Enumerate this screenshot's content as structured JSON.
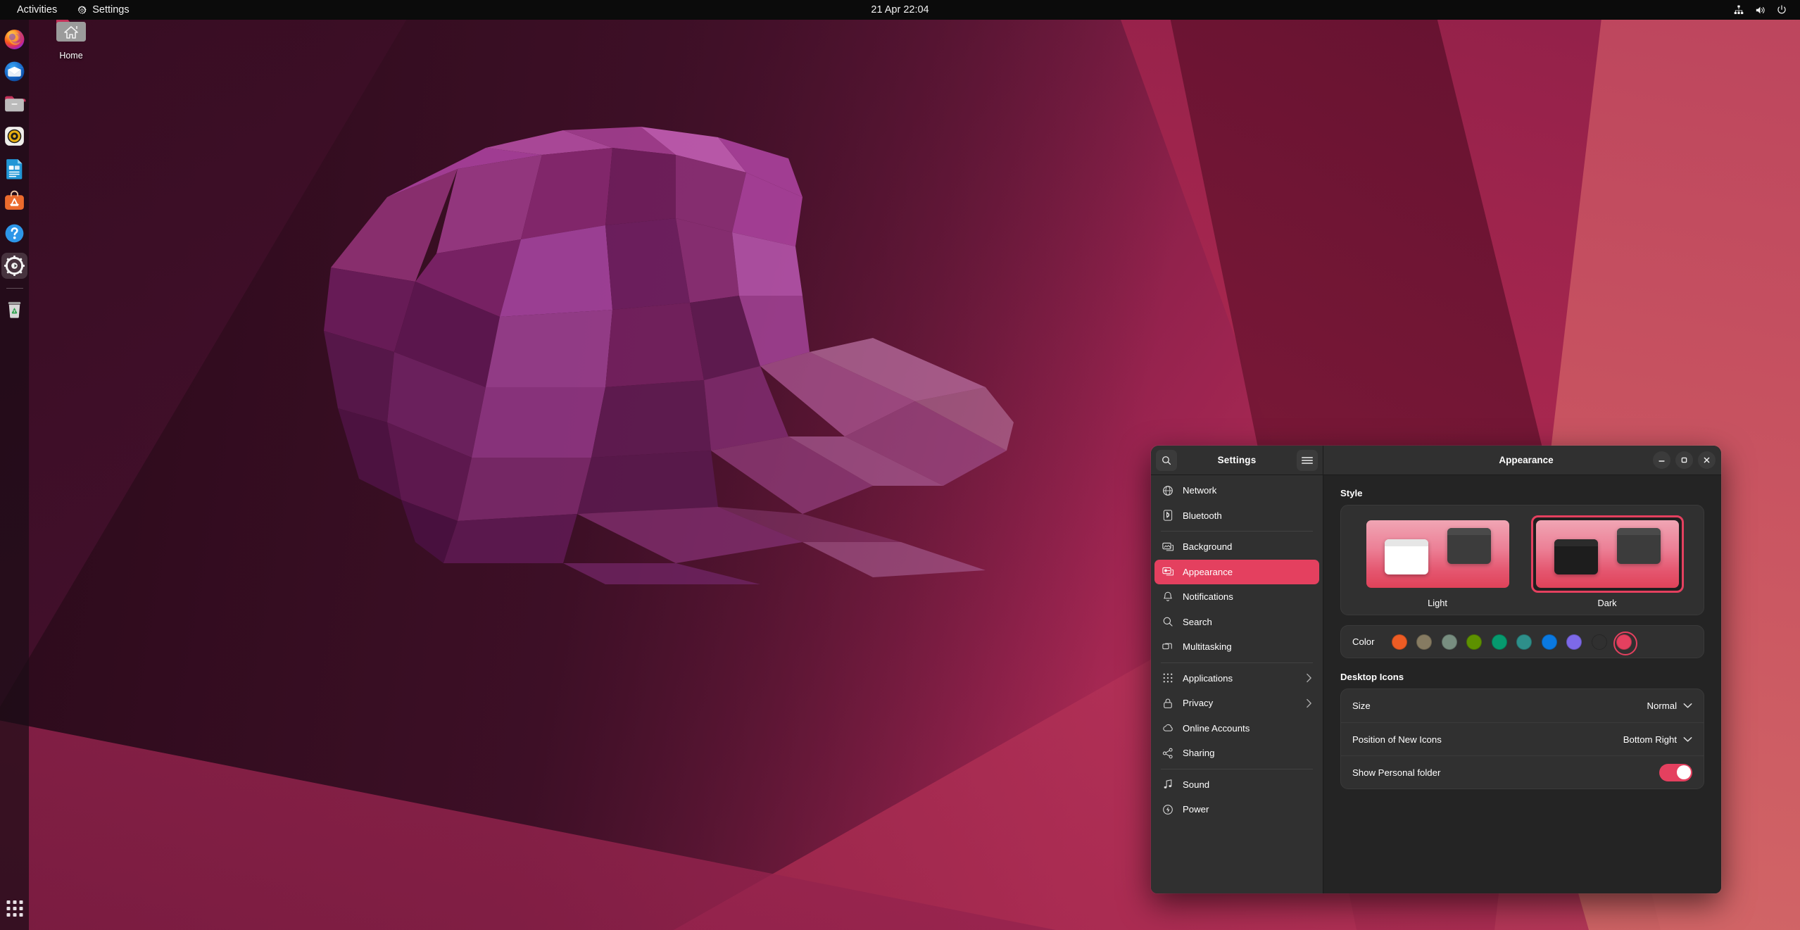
{
  "topbar": {
    "activities": "Activities",
    "app_menu": "Settings",
    "app_menu_icon": "gear-icon",
    "clock": "21 Apr  22:04",
    "indicators": [
      "network-icon",
      "volume-icon",
      "power-icon"
    ]
  },
  "dock": {
    "items": [
      {
        "name": "firefox",
        "label": "Firefox",
        "running": false
      },
      {
        "name": "thunderbird",
        "label": "Thunderbird",
        "running": false
      },
      {
        "name": "files",
        "label": "Files",
        "running": false
      },
      {
        "name": "rhythmbox",
        "label": "Rhythmbox",
        "running": false
      },
      {
        "name": "libreoffice-writer",
        "label": "LibreOffice Writer",
        "running": false
      },
      {
        "name": "app-center",
        "label": "Ubuntu Software",
        "running": false
      },
      {
        "name": "help",
        "label": "Help",
        "running": false
      },
      {
        "name": "settings",
        "label": "Settings",
        "running": true
      }
    ],
    "trash_label": "Trash",
    "show_apps_label": "Show Applications"
  },
  "desktop": {
    "home_icon_label": "Home"
  },
  "window": {
    "sidebar_title": "Settings",
    "content_title": "Appearance",
    "search_icon": "search-icon",
    "menu_icon": "hamburger-menu-icon",
    "controls": {
      "minimize": "minimize-icon",
      "maximize": "maximize-icon",
      "close": "close-icon"
    }
  },
  "sidebar": {
    "items": [
      {
        "label": "Network",
        "icon": "globe-icon",
        "selected": false,
        "submenu": false,
        "sep_after": false
      },
      {
        "label": "Bluetooth",
        "icon": "bluetooth-icon",
        "selected": false,
        "submenu": false,
        "sep_after": true
      },
      {
        "label": "Background",
        "icon": "wallpaper-icon",
        "selected": false,
        "submenu": false,
        "sep_after": false
      },
      {
        "label": "Appearance",
        "icon": "appearance-icon",
        "selected": true,
        "submenu": false,
        "sep_after": false
      },
      {
        "label": "Notifications",
        "icon": "bell-icon",
        "selected": false,
        "submenu": false,
        "sep_after": false
      },
      {
        "label": "Search",
        "icon": "search-icon",
        "selected": false,
        "submenu": false,
        "sep_after": false
      },
      {
        "label": "Multitasking",
        "icon": "windows-icon",
        "selected": false,
        "submenu": false,
        "sep_after": true
      },
      {
        "label": "Applications",
        "icon": "grid-icon",
        "selected": false,
        "submenu": true,
        "sep_after": false
      },
      {
        "label": "Privacy",
        "icon": "lock-icon",
        "selected": false,
        "submenu": true,
        "sep_after": false
      },
      {
        "label": "Online Accounts",
        "icon": "cloud-icon",
        "selected": false,
        "submenu": false,
        "sep_after": false
      },
      {
        "label": "Sharing",
        "icon": "share-icon",
        "selected": false,
        "submenu": false,
        "sep_after": true
      },
      {
        "label": "Sound",
        "icon": "music-note-icon",
        "selected": false,
        "submenu": false,
        "sep_after": false
      },
      {
        "label": "Power",
        "icon": "power-bolt-icon",
        "selected": false,
        "submenu": false,
        "sep_after": false
      }
    ]
  },
  "appearance": {
    "style_section_title": "Style",
    "styles": [
      {
        "label": "Light",
        "selected": false
      },
      {
        "label": "Dark",
        "selected": true
      }
    ],
    "color_label": "Color",
    "accent_selected": "#e4405f",
    "colors": [
      {
        "name": "orange",
        "hex": "#ed5c24",
        "selected": false
      },
      {
        "name": "bark",
        "hex": "#867b62",
        "selected": false
      },
      {
        "name": "sage",
        "hex": "#788e80",
        "selected": false
      },
      {
        "name": "olive",
        "hex": "#5d9100",
        "selected": false
      },
      {
        "name": "viridian",
        "hex": "#069a6e",
        "selected": false
      },
      {
        "name": "prussian",
        "hex": "#2e8f8a",
        "selected": false
      },
      {
        "name": "blue",
        "hex": "#0a79e0",
        "selected": false
      },
      {
        "name": "purple",
        "hex": "#7d69e8",
        "selected": false
      },
      {
        "name": "magenta",
        "hex": "#c martinez",
        "selected": false
      },
      {
        "name": "red",
        "hex": "#e4405f",
        "selected": true
      }
    ],
    "desktop_icons_title": "Desktop Icons",
    "rows": [
      {
        "label": "Size",
        "value": "Normal",
        "type": "dropdown"
      },
      {
        "label": "Position of New Icons",
        "value": "Bottom Right",
        "type": "dropdown"
      },
      {
        "label": "Show Personal folder",
        "value": "on",
        "type": "toggle"
      }
    ]
  }
}
